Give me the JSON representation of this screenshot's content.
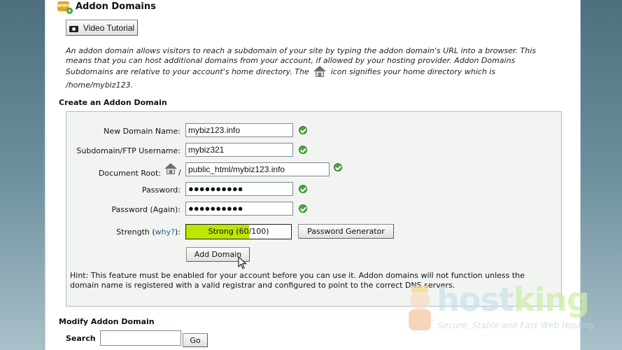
{
  "header": {
    "title": "Addon Domains",
    "video_button": "Video Tutorial"
  },
  "intro": {
    "text_before_icon": "An addon domain allows visitors to reach a subdomain of your site by typing the addon domain's URL into a browser. This means that you can host additional domains from your account, if allowed by your hosting provider. Addon Domains Subdomains are relative to your account's home directory. The",
    "text_after_icon": "icon signifies your home directory which is",
    "home_path": "/home/mybiz123."
  },
  "create": {
    "title": "Create an Addon Domain",
    "fields": {
      "new_domain": {
        "label": "New Domain Name:",
        "value": "mybiz123.info"
      },
      "subdomain": {
        "label": "Subdomain/FTP Username:",
        "value": "mybiz321"
      },
      "document_root": {
        "label": "Document Root:",
        "prefix": "/",
        "value": "public_html/mybiz123.info"
      },
      "password": {
        "label": "Password:",
        "value": "●●●●●●●●●●"
      },
      "password_again": {
        "label": "Password (Again):",
        "value": "●●●●●●●●●●"
      }
    },
    "strength": {
      "label_before": "Strength (",
      "link": "why?",
      "label_after": "):",
      "text": "Strong (60/100)",
      "value": 60,
      "max": 100,
      "fill_color": "#bde600"
    },
    "password_generator": "Password Generator",
    "add_button": "Add Domain",
    "hint": "Hint: This feature must be enabled for your account before you can use it. Addon domains will not function unless the domain name is registered with a valid registrar and configured to point to the correct DNS servers."
  },
  "modify": {
    "title": "Modify Addon Domain",
    "search_label": "Search",
    "search_value": "",
    "go_button": "Go"
  },
  "watermark": {
    "brand_host": "host",
    "brand_king": "king",
    "tagline": "Secure, Stable and Fast Web Hosting"
  },
  "colors": {
    "valid_check": "#48a83b",
    "link": "#2b5f98",
    "form_bg": "#f2f4f2"
  }
}
